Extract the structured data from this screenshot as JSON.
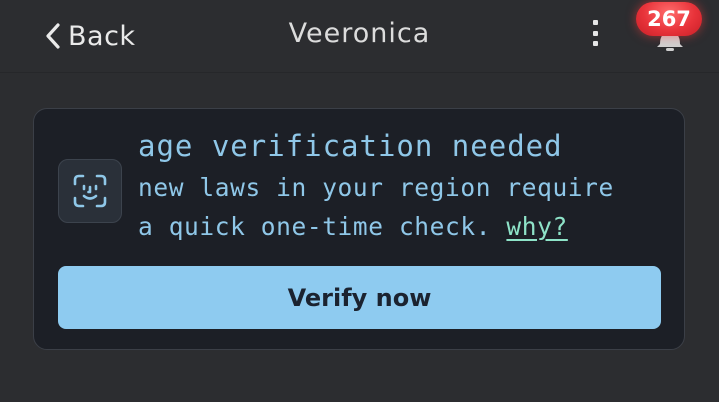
{
  "header": {
    "back_label": "Back",
    "title": "Veeronica",
    "notification_count": "267"
  },
  "card": {
    "heading": "age verification needed",
    "body_line1": "new laws in your region require",
    "body_line2": "a quick one-time check.",
    "why_link": "why?",
    "verify_button": "Verify now"
  },
  "icons": {
    "back": "chevron-left-icon",
    "menu": "more-vertical-icon",
    "notifications": "bell-icon",
    "face_scan": "face-scan-icon"
  },
  "colors": {
    "background": "#2c2d30",
    "card_background": "#1c1f26",
    "card_text": "#8fc7e8",
    "link": "#8ee3c8",
    "button": "#8ecbf0",
    "badge": "#e8333a"
  }
}
